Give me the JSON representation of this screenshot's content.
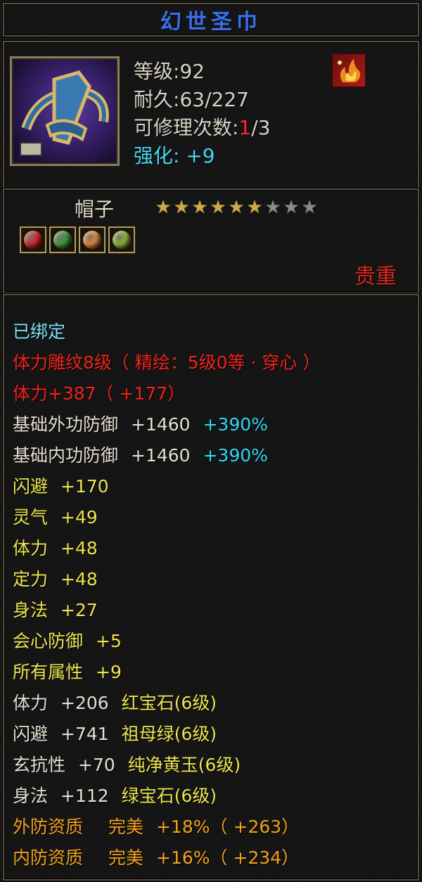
{
  "item": {
    "name": "幻世圣巾",
    "type": "帽子",
    "quality": "贵重"
  },
  "header": {
    "level_label": "等级",
    "level_value": ":92",
    "durability_label": "耐久",
    "durability_value": ":63/227",
    "repair_label": "可修理次数",
    "repair_sep": ":",
    "repair_used": "1",
    "repair_total": "/3",
    "enhance_label": "强化:",
    "enhance_value": "+9"
  },
  "stars": {
    "filled": 6,
    "total": 9
  },
  "gems": [
    {
      "icon": "red-gem-icon",
      "color": "#d8242c"
    },
    {
      "icon": "green-gem-icon",
      "color": "#3c9a3a"
    },
    {
      "icon": "amber-gem-icon",
      "color": "#e08a3a"
    },
    {
      "icon": "lime-gem-icon",
      "color": "#8ab832"
    }
  ],
  "properties": {
    "bound": "已绑定",
    "engraving": "体力雕纹8级（ 精绘：5级0等 · 穿心 ）",
    "vitality_main": "体力+387（ +177）",
    "ext_def": {
      "label": "基础外功防御",
      "value": "+1460",
      "bonus": "+390%"
    },
    "int_def": {
      "label": "基础内功防御",
      "value": "+1460",
      "bonus": "+390%"
    },
    "attrs": [
      {
        "label": "闪避",
        "value": "+170"
      },
      {
        "label": "灵气",
        "value": "+49"
      },
      {
        "label": "体力",
        "value": "+48"
      },
      {
        "label": "定力",
        "value": "+48"
      },
      {
        "label": "身法",
        "value": "+27"
      },
      {
        "label": "会心防御",
        "value": "+5"
      },
      {
        "label": "所有属性",
        "value": "+9"
      }
    ],
    "gem_attrs": [
      {
        "label": "体力",
        "value": "+206",
        "gem": "红宝石(6级)"
      },
      {
        "label": "闪避",
        "value": "+741",
        "gem": "祖母绿(6级)"
      },
      {
        "label": "玄抗性",
        "value": "+70",
        "gem": "纯净黄玉(6级)"
      },
      {
        "label": "身法",
        "value": "+112",
        "gem": "绿宝石(6级)"
      }
    ],
    "aptitudes": [
      {
        "label": "外防资质",
        "grade": "完美",
        "value": "+18%（ +263）"
      },
      {
        "label": "内防资质",
        "grade": "完美",
        "value": "+16%（ +234）"
      }
    ]
  },
  "colors": {
    "title": "#3c6fe6",
    "red": "#f0241c",
    "cyan": "#2fdbf0",
    "yellow": "#ece450",
    "orange": "#f0a21e",
    "star_on": "#c8aa4a",
    "star_off": "#8a8a8a"
  }
}
